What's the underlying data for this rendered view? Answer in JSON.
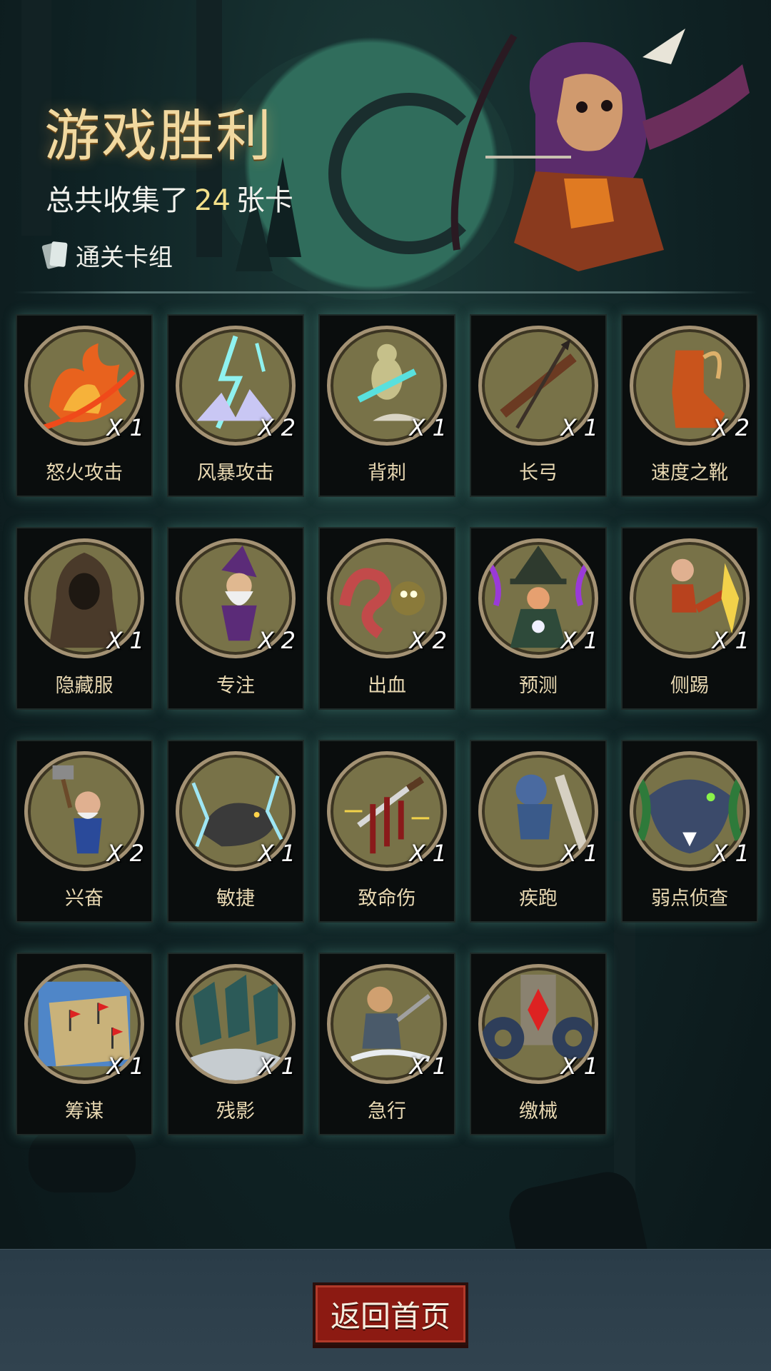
{
  "header": {
    "title": "游戏胜利",
    "summary_prefix": "总共收集了",
    "card_count": "24",
    "summary_suffix": "张卡",
    "deck_link_label": "通关卡组"
  },
  "cards": [
    {
      "name": "怒火攻击",
      "qty": "X 1",
      "icon": "flame-slash-icon"
    },
    {
      "name": "风暴攻击",
      "qty": "X 2",
      "icon": "lightning-burst-icon"
    },
    {
      "name": "背刺",
      "qty": "X 1",
      "icon": "backstab-icon"
    },
    {
      "name": "长弓",
      "qty": "X 1",
      "icon": "longbow-icon"
    },
    {
      "name": "速度之靴",
      "qty": "X 2",
      "icon": "winged-boot-icon"
    },
    {
      "name": "隐藏服",
      "qty": "X 1",
      "icon": "hooded-cloak-icon"
    },
    {
      "name": "专注",
      "qty": "X 2",
      "icon": "wizard-icon"
    },
    {
      "name": "出血",
      "qty": "X 2",
      "icon": "tentacle-monster-icon"
    },
    {
      "name": "预测",
      "qty": "X 1",
      "icon": "witch-crystal-ball-icon"
    },
    {
      "name": "侧踢",
      "qty": "X 1",
      "icon": "kick-icon"
    },
    {
      "name": "兴奋",
      "qty": "X 2",
      "icon": "hammer-dwarf-icon"
    },
    {
      "name": "敏捷",
      "qty": "X 1",
      "icon": "panther-icon"
    },
    {
      "name": "致命伤",
      "qty": "X 1",
      "icon": "bleeding-dagger-icon"
    },
    {
      "name": "疾跑",
      "qty": "X 1",
      "icon": "running-beast-icon"
    },
    {
      "name": "弱点侦查",
      "qty": "X 1",
      "icon": "wolf-head-icon"
    },
    {
      "name": "筹谋",
      "qty": "X 1",
      "icon": "map-flags-icon"
    },
    {
      "name": "残影",
      "qty": "X 1",
      "icon": "afterimage-icon"
    },
    {
      "name": "急行",
      "qty": "X 1",
      "icon": "charging-warrior-icon"
    },
    {
      "name": "缴械",
      "qty": "X 1",
      "icon": "disarm-gears-icon"
    }
  ],
  "footer": {
    "home_button": "返回首页"
  },
  "colors": {
    "title_gold": "#f1d9a0",
    "count_yellow": "#f4e08a",
    "card_name": "#e8d8b2",
    "button_red": "#8c1a12",
    "art_olive": "#787248"
  }
}
